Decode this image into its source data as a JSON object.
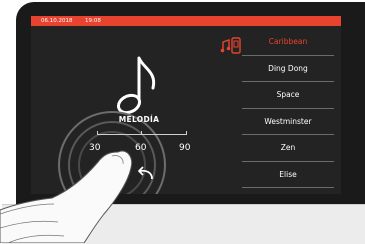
{
  "status_bar": {
    "date": "06.10.2018",
    "time": "19:08",
    "color": "#e8432f"
  },
  "main": {
    "icon": "music-note-icon",
    "label": "MELODÍA",
    "scale": [
      "30",
      "60",
      "90"
    ],
    "back_icon": "back-arrow-icon"
  },
  "melody_list": {
    "icon": "melody-phone-icon",
    "items": [
      "Caribbean",
      "Ding Dong",
      "Space",
      "Westminster",
      "Zen",
      "Elise"
    ],
    "selected": "Caribbean",
    "accent": "#e8432f"
  }
}
